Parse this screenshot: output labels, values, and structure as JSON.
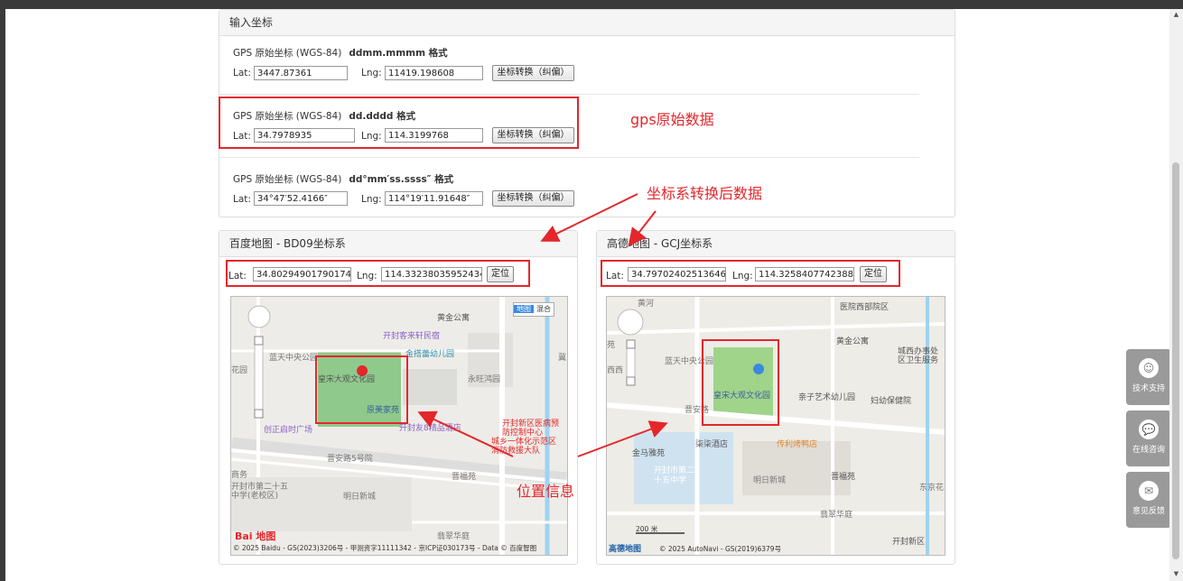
{
  "input_panel": {
    "title": "输入坐标",
    "rows": [
      {
        "label": "GPS 原始坐标 (WGS-84)",
        "format": "ddmm.mmmm 格式",
        "lat_label": "Lat:",
        "lat": "3447.87361",
        "lng_label": "Lng:",
        "lng": "11419.198608",
        "button": "坐标转换（纠偏）"
      },
      {
        "label": "GPS 原始坐标 (WGS-84)",
        "format": "dd.dddd 格式",
        "lat_label": "Lat:",
        "lat": "34.7978935",
        "lng_label": "Lng:",
        "lng": "114.3199768",
        "button": "坐标转换（纠偏）"
      },
      {
        "label": "GPS 原始坐标 (WGS-84)",
        "format": "dd°mm′ss.ssss″ 格式",
        "lat_label": "Lat:",
        "lat": "34°47′52.4166″",
        "lng_label": "Lng:",
        "lng": "114°19′11.91648″",
        "button": "坐标转换（纠偏）"
      }
    ]
  },
  "baidu_panel": {
    "title": "百度地图 - BD09坐标系",
    "lat_label": "Lat:",
    "lat": "34.80294901790174",
    "lng_label": "Lng:",
    "lng": "114.33238035952434",
    "button": "定位",
    "map_type_buttons": [
      "地图",
      "混合"
    ],
    "labels": [
      "黄金公寓",
      "开封客来轩民宿",
      "金搭蕾幼儿园",
      "蓝天中央公园",
      "花园",
      "永旺鸿园",
      "皇宋大观文化园",
      "原美家苑",
      "开封友8精品酒店",
      "创正启时广场",
      "开封市第二十五中学(老校区)",
      "晋安路5号院",
      "明日新城",
      "晋福苑",
      "翡翠华庭",
      "开封新区医病预防控制中心",
      "城乡一体化示范区消防救援大队",
      "商务",
      "冀"
    ],
    "logo": "Bai 地图",
    "copyright": "© 2025 Baidu - GS(2023)3206号 - 甲测资字11111342 - 京ICP证030173号 - Data © 百度智图"
  },
  "amap_panel": {
    "title": "高德地图 - GCJ坐标系",
    "lat_label": "Lat:",
    "lat": "34.797024025136466",
    "lng_label": "Lng:",
    "lng": "114.32584077423886",
    "button": "定位",
    "labels": [
      "医院西部院区",
      "黄金公寓",
      "蓝天中央公园",
      "西西",
      "城西办事处区卫生服务",
      "皇宋大观文化园",
      "亲子艺术幼儿园",
      "妇幼保健院",
      "晋安路",
      "柒柒酒店",
      "传利烤鸭店",
      "金马雅苑",
      "开封市第二十五中学",
      "明日新城",
      "晋福苑",
      "东京花",
      "翡翠华庭",
      "开封新区",
      "黄河",
      "苑"
    ],
    "scale": "200 米",
    "logo": "高德地图",
    "copyright": "© 2025 AutoNavi - GS(2019)6379号"
  },
  "annotations": {
    "gps_raw": "gps原始数据",
    "converted": "坐标系转换后数据",
    "position": "位置信息"
  },
  "side_buttons": [
    {
      "label": "技术支持",
      "icon": "monkey-icon"
    },
    {
      "label": "在线咨询",
      "icon": "chat-icon"
    },
    {
      "label": "意见反馈",
      "icon": "feedback-icon"
    }
  ],
  "colors": {
    "annotation_red": "#e3272b",
    "side_button_bg": "#9a9a9a",
    "panel_head_bg": "#f5f5f5"
  }
}
